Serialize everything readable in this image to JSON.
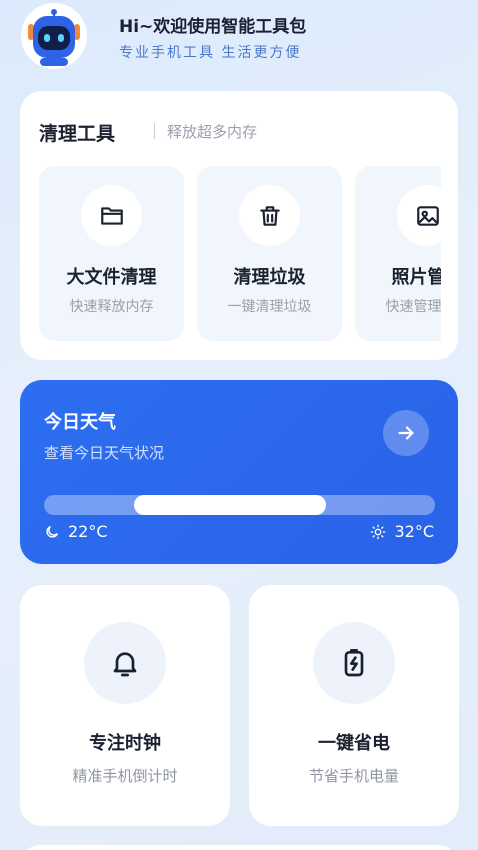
{
  "header": {
    "title": "Hi~欢迎使用智能工具包",
    "subtitle": "专业手机工具 生活更方便",
    "avatar_icon": "robot-icon"
  },
  "clean_tools": {
    "title": "清理工具",
    "subtitle": "释放超多内存",
    "items": [
      {
        "name": "大文件清理",
        "desc": "快速释放内存",
        "icon": "folder-icon"
      },
      {
        "name": "清理垃圾",
        "desc": "一键清理垃圾",
        "icon": "trash-icon"
      },
      {
        "name": "照片管理",
        "desc": "快速管理照片",
        "icon": "image-icon"
      }
    ]
  },
  "weather": {
    "title": "今日天气",
    "subtitle": "查看今日天气状况",
    "low": "22°C",
    "high": "32°C",
    "range_fill_start": 0.23,
    "range_fill_end": 0.72,
    "accent": "#2d6ef0"
  },
  "features": [
    {
      "name": "专注时钟",
      "desc": "精准手机倒计时",
      "icon": "bell-icon"
    },
    {
      "name": "一键省电",
      "desc": "节省手机电量",
      "icon": "battery-charge-icon"
    }
  ]
}
